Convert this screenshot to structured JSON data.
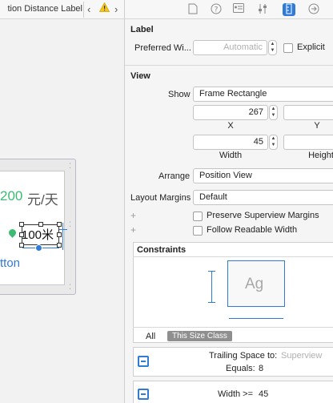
{
  "canvas": {
    "breadcrumb": "tion Distance Label",
    "nav_back": "‹",
    "nav_forward": "›",
    "warning_icon": "warning-triangle-icon",
    "price_value": "200",
    "price_unit": "元/天",
    "distance_label": "100米",
    "button_text": "tton"
  },
  "inspector": {
    "tabs": [
      "file-inspector-icon",
      "quick-help-icon",
      "identity-inspector-icon",
      "attributes-inspector-icon",
      "size-inspector-icon",
      "connections-inspector-icon"
    ],
    "label_section": {
      "title": "Label",
      "preferred_width_label": "Preferred Wi...",
      "preferred_width_placeholder": "Automatic",
      "explicit_label": "Explicit",
      "explicit_checked": false
    },
    "view_section": {
      "title": "View",
      "show_label": "Show",
      "show_value": "Frame Rectangle",
      "x_value": "267",
      "x_label": "X",
      "y_label": "Y",
      "width_value": "45",
      "width_label": "Width",
      "height_label": "Height",
      "arrange_label": "Arrange",
      "arrange_value": "Position View",
      "layout_margins_label": "Layout Margins",
      "layout_margins_value": "Default",
      "preserve_label": "Preserve Superview Margins",
      "follow_label": "Follow Readable Width"
    },
    "constraints": {
      "title": "Constraints",
      "preview_text": "Ag",
      "filter_all": "All",
      "filter_size_class": "This Size Class",
      "items": [
        {
          "name": "Trailing Space to:",
          "target": "Superview",
          "equals_label": "Equals:",
          "equals_value": "8"
        },
        {
          "name": "Width >=",
          "value": "45"
        }
      ]
    },
    "accent_color": "#2f7bd6",
    "label_green": "#3cbb73"
  }
}
